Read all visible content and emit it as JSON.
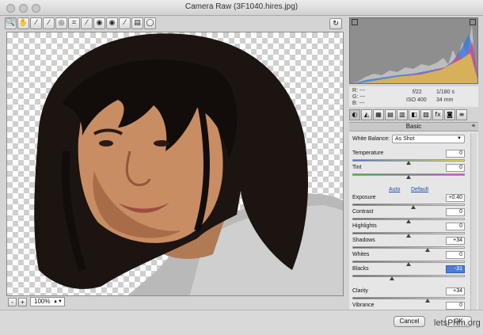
{
  "window": {
    "title": "Camera Raw (3F1040.hires.jpg)"
  },
  "toolbar": {
    "tools": [
      {
        "name": "zoom-tool",
        "icon": "🔍"
      },
      {
        "name": "hand-tool",
        "icon": "✋"
      },
      {
        "name": "white-balance-tool",
        "icon": "⁄"
      },
      {
        "name": "color-sampler-tool",
        "icon": "⁄"
      },
      {
        "name": "targeted-adjustment-tool",
        "icon": "◎"
      },
      {
        "name": "crop-tool",
        "icon": "⌗"
      },
      {
        "name": "straighten-tool",
        "icon": "⁄"
      },
      {
        "name": "spot-removal-tool",
        "icon": "◉"
      },
      {
        "name": "red-eye-tool",
        "icon": "◉"
      },
      {
        "name": "adjustment-brush-tool",
        "icon": "⁄"
      },
      {
        "name": "graduated-filter-tool",
        "icon": "▤"
      },
      {
        "name": "radial-filter-tool",
        "icon": "◯"
      }
    ],
    "rotate_icon": "↻"
  },
  "status": {
    "zoom_value": "100%",
    "zoom_out": "-",
    "zoom_in": "+"
  },
  "exif": {
    "r_label": "R:",
    "g_label": "G:",
    "b_label": "B:",
    "r_value": "---",
    "g_value": "---",
    "b_value": "---",
    "aperture": "f/22",
    "shutter": "1/180 s",
    "iso": "ISO 400",
    "focal": "34 mm"
  },
  "panel": {
    "section_title": "Basic",
    "tab_icons": [
      "◐",
      "◭",
      "▦",
      "▤",
      "▥",
      "◧",
      "▨",
      "fx",
      "◙",
      "≡"
    ],
    "white_balance_label": "White Balance:",
    "white_balance_value": "As Shot",
    "auto_label": "Auto",
    "default_label": "Default",
    "sliders": [
      {
        "label": "Temperature",
        "value": "0",
        "level": 0.5
      },
      {
        "label": "Tint",
        "value": "0",
        "level": 0.5
      },
      {
        "label": "Exposure",
        "value": "+0.40",
        "level": 0.54
      },
      {
        "label": "Contrast",
        "value": "0",
        "level": 0.5
      },
      {
        "label": "Highlights",
        "value": "0",
        "level": 0.5
      },
      {
        "label": "Shadows",
        "value": "+34",
        "level": 0.67
      },
      {
        "label": "Whites",
        "value": "0",
        "level": 0.5
      },
      {
        "label": "Blacks",
        "value": "-31",
        "level": 0.35
      },
      {
        "label": "Clarity",
        "value": "+34",
        "level": 0.67
      },
      {
        "label": "Vibrance",
        "value": "0",
        "level": 0.5
      }
    ]
  },
  "buttons": {
    "cancel": "Cancel",
    "ok": "OK"
  },
  "watermark": "letsPhm.org",
  "colors": {
    "selection": "#4b7fd6",
    "link": "#1f4fa5"
  }
}
